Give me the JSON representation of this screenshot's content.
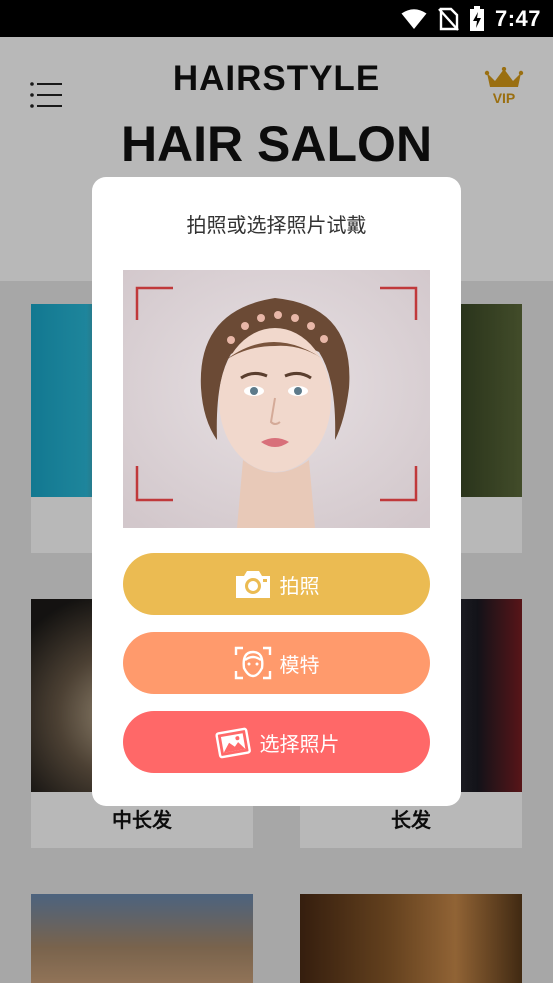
{
  "status_bar": {
    "time": "7:47",
    "icons": [
      "wifi-icon",
      "no-sim-icon",
      "battery-charging-icon"
    ]
  },
  "header": {
    "title": "HAIRSTYLE",
    "subtitle": "HAIR SALON",
    "menu_icon": "menu-icon",
    "vip_label": "VIP"
  },
  "grid": {
    "cards": [
      {
        "label": ""
      },
      {
        "label": ""
      },
      {
        "label": "中长发"
      },
      {
        "label": "长发"
      },
      {
        "label": ""
      },
      {
        "label": ""
      }
    ]
  },
  "dialog": {
    "title": "拍照或选择照片试戴",
    "buttons": [
      {
        "label": "拍照",
        "icon": "camera-icon",
        "color": "#ebbb52"
      },
      {
        "label": "模特",
        "icon": "face-scan-icon",
        "color": "#ff9a6c"
      },
      {
        "label": "选择照片",
        "icon": "gallery-icon",
        "color": "#ff6868"
      }
    ]
  },
  "colors": {
    "accent_gold": "#d69a18",
    "frame_corner": "#c0393b"
  }
}
